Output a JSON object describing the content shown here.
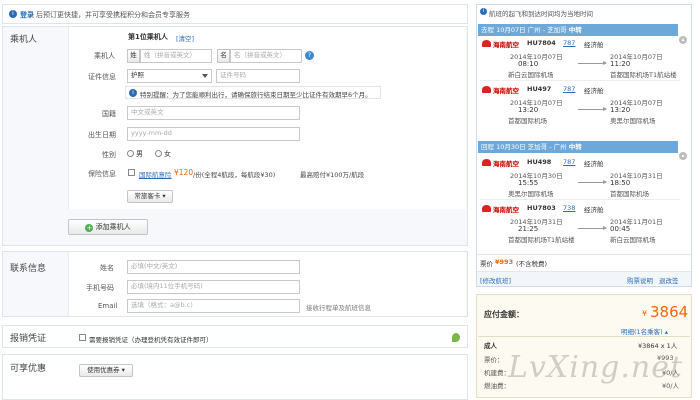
{
  "notice": {
    "link": "登录",
    "text": "后预订更快捷，并可享受携程积分和会员专享服务"
  },
  "passenger": {
    "section_title": "乘机人",
    "first_label": "第1位乘机人",
    "clear": "[清空]",
    "name_label": "乘机人",
    "surname_btn": "姓",
    "surname_ph": "姓（拼音或英文）",
    "given_btn": "名",
    "given_ph": "名（拼音或英文）",
    "id_label": "证件信息",
    "id_type": "护照",
    "id_no_ph": "证件号码",
    "tip": "特别提醒：为了您能顺利出行，请确保旅行结束日期至少比证件有效期早6个月。",
    "nationality_label": "国籍",
    "nationality_ph": "中文或英文",
    "birthday_label": "出生日期",
    "birthday_ph": "yyyy-mm-dd",
    "gender_label": "性别",
    "male": "男",
    "female": "女",
    "insurance_label": "保险信息",
    "insurance_name": "国际航意险",
    "insurance_price": "¥120",
    "insurance_rest": "/份(全程4航段，每航段¥30)",
    "insurance_max": "最高赔付¥100万/航段",
    "frequent_btn": "常旅客卡",
    "add_btn": "添加乘机人"
  },
  "contact": {
    "section_title": "联系信息",
    "name_label": "姓名",
    "name_ph": "必填(中文/英文)",
    "phone_label": "手机号码",
    "phone_ph": "必填(境内11位手机号码)",
    "email_label": "Email",
    "email_ph": "选填（格式：a@b.c）",
    "email_note": "接收行程单及航班信息"
  },
  "receipt": {
    "section_title": "报销凭证",
    "checkbox_label": "需要报销凭证（办理登机凭有效证件即可）"
  },
  "discount": {
    "section_title": "可享优惠",
    "btn": "使用优惠券"
  },
  "sidebar": {
    "top_note": "航班的起飞和到达时间均为当地时间",
    "outbound_header": "去程 10月07日 广州 - 芝加哥",
    "return_header": "回程 10月30日 芝加哥 - 广州",
    "hdr_badge": "中转",
    "flights": [
      {
        "airline": "海南航空",
        "no": "HU7804",
        "aircraft": "787",
        "cabin": "经济舱",
        "dep_date": "2014年10月07日",
        "dep_time": "08:10",
        "dep_ap": "新白云国际机场",
        "arr_date": "2014年10月07日",
        "arr_time": "11:20",
        "arr_ap": "首都国际机场T1航站楼"
      },
      {
        "airline": "海南航空",
        "no": "HU497",
        "aircraft": "787",
        "cabin": "经济舱",
        "dep_date": "2014年10月07日",
        "dep_time": "13:20",
        "dep_ap": "首都国际机场",
        "arr_date": "2014年10月07日",
        "arr_time": "13:20",
        "arr_ap": "奥黑尔国际机场"
      },
      {
        "airline": "海南航空",
        "no": "HU498",
        "aircraft": "787",
        "cabin": "经济舱",
        "dep_date": "2014年10月30日",
        "dep_time": "15:55",
        "dep_ap": "奥黑尔国际机场",
        "arr_date": "2014年10月31日",
        "arr_time": "18:50",
        "arr_ap": "首都国际机场"
      },
      {
        "airline": "海南航空",
        "no": "HU7803",
        "aircraft": "738",
        "cabin": "经济舱",
        "dep_date": "2014年10月31日",
        "dep_time": "21:25",
        "dep_ap": "首都国际机场T1航站楼",
        "arr_date": "2014年11月01日",
        "arr_time": "00:45",
        "arr_ap": "新白云国际机场"
      }
    ],
    "price_label": "票价",
    "price": "¥993",
    "price_note": "(不含税费)",
    "change_link": "[修改航班]",
    "rule_link": "购票说明",
    "refund_link": "退改签"
  },
  "total": {
    "label": "应付金额：",
    "currency": "¥",
    "amount": "3864",
    "detail_link": "明细",
    "detail_count": "(1名乘客)",
    "adult_label": "成人",
    "adult_val": "¥3864 x 1人",
    "ticket_label": "票价：",
    "ticket_val": "¥993",
    "tax_label": "机建费：",
    "tax_val": "¥0/人",
    "fuel_label": "燃油费：",
    "fuel_val": "¥0/人"
  },
  "watermark": "LvXing.net",
  "colors": {
    "link": "#2b6cb8",
    "accent": "#f60",
    "header": "#6ea8d8"
  }
}
